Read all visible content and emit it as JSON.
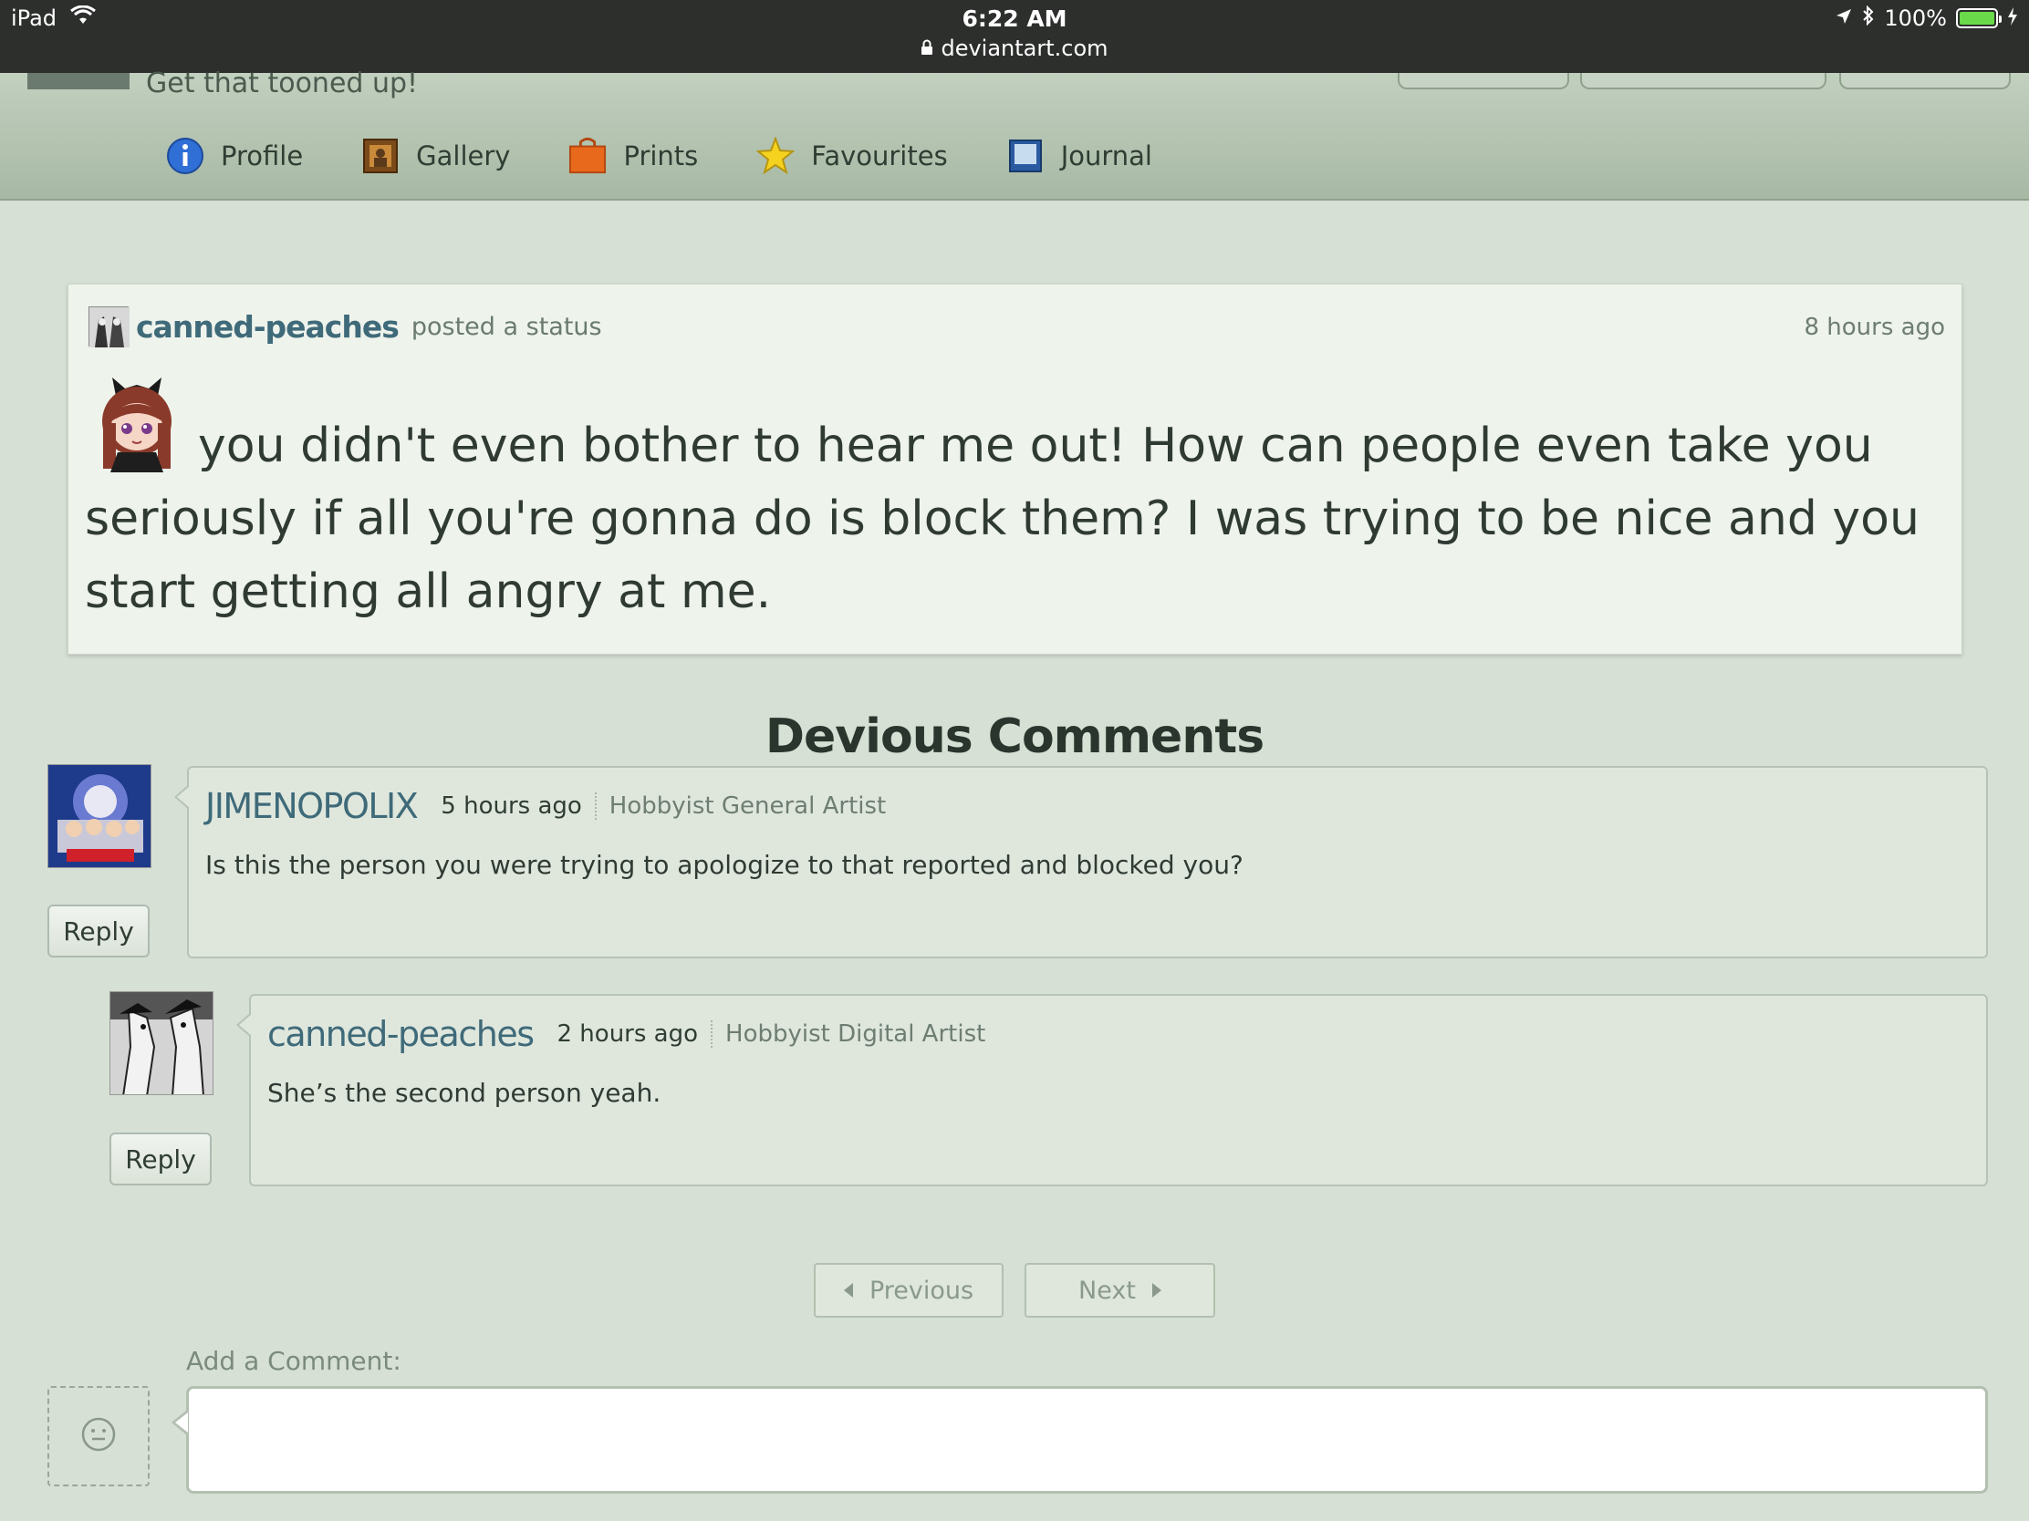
{
  "status_bar": {
    "device": "iPad",
    "time": "6:22 AM",
    "url": "deviantart.com",
    "battery": "100%",
    "battery_level": 1.0
  },
  "profile_header": {
    "tagline": "Get that tooned up!"
  },
  "nav": {
    "items": [
      {
        "label": "Profile",
        "icon": "info-icon"
      },
      {
        "label": "Gallery",
        "icon": "gallery-icon"
      },
      {
        "label": "Prints",
        "icon": "prints-bag-icon"
      },
      {
        "label": "Favourites",
        "icon": "star-icon"
      },
      {
        "label": "Journal",
        "icon": "journal-icon"
      }
    ]
  },
  "status_post": {
    "username": "canned-peaches",
    "action": "posted a status",
    "time": "8 hours ago",
    "text": "you didn't even bother to hear me out! How can people even take you seriously if all you're gonna do is block them? I was trying to be nice and you start getting all angry at me."
  },
  "comments": {
    "title": "Devious Comments",
    "items": [
      {
        "username": "JIMENOPOLIX",
        "time": "5 hours ago",
        "role": "Hobbyist General Artist",
        "text": "Is this the person you were trying to apologize to that reported and blocked you?",
        "reply_label": "Reply"
      },
      {
        "username": "canned-peaches",
        "time": "2 hours ago",
        "role": "Hobbyist Digital Artist",
        "text": "She’s the second person yeah.",
        "reply_label": "Reply"
      }
    ]
  },
  "pagination": {
    "previous_label": "Previous",
    "next_label": "Next"
  },
  "add_comment": {
    "label": "Add a Comment:",
    "value": "",
    "placeholder": ""
  },
  "colors": {
    "page_bg": "#d6e0d4",
    "username_link": "#3f6a79",
    "status_bar_bg": "#2d2f2d"
  }
}
